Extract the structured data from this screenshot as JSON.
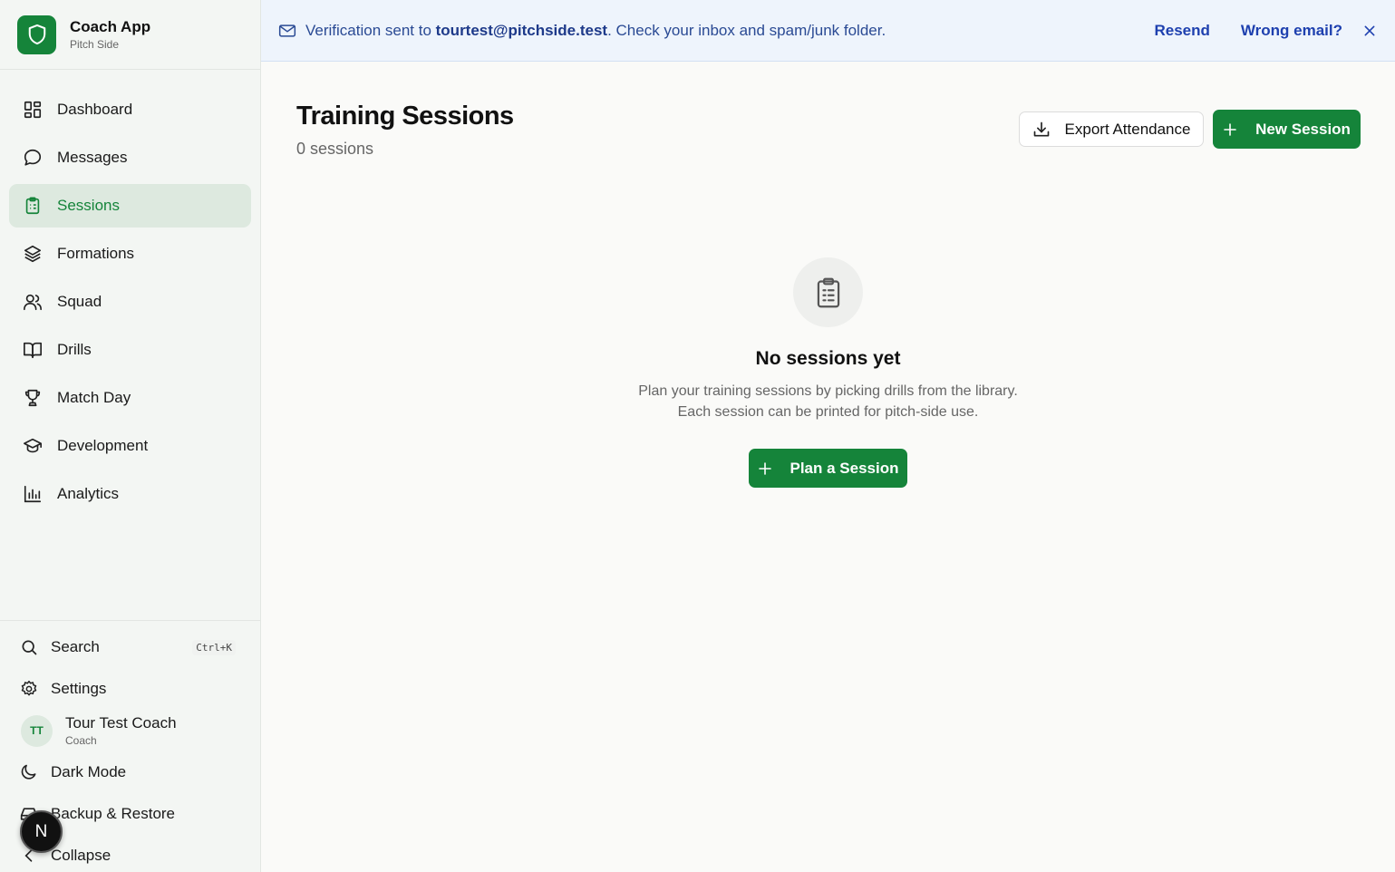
{
  "brand": {
    "title": "Coach App",
    "subtitle": "Pitch Side"
  },
  "nav": {
    "items": [
      {
        "label": "Dashboard",
        "icon": "dashboard-icon"
      },
      {
        "label": "Messages",
        "icon": "message-icon"
      },
      {
        "label": "Sessions",
        "icon": "clipboard-icon",
        "active": true
      },
      {
        "label": "Formations",
        "icon": "layers-icon"
      },
      {
        "label": "Squad",
        "icon": "users-icon"
      },
      {
        "label": "Drills",
        "icon": "book-icon"
      },
      {
        "label": "Match Day",
        "icon": "trophy-icon"
      },
      {
        "label": "Development",
        "icon": "graduation-cap-icon"
      },
      {
        "label": "Analytics",
        "icon": "bar-chart-icon"
      }
    ]
  },
  "bottom": {
    "search_label": "Search",
    "search_shortcut": "Ctrl+K",
    "settings_label": "Settings",
    "user_initials": "TT",
    "user_name": "Tour Test Coach",
    "user_role": "Coach",
    "dark_mode_label": "Dark Mode",
    "backup_label": "Backup & Restore",
    "collapse_label": "Collapse",
    "fab_label": "N"
  },
  "banner": {
    "prefix": "Verification sent to ",
    "email": "tourtest@pitchside.test",
    "suffix": ". Check your inbox and spam/junk folder.",
    "resend_label": "Resend",
    "wrong_email_label": "Wrong email?"
  },
  "header": {
    "title": "Training Sessions",
    "count_text": "0 sessions",
    "export_label": "Export Attendance",
    "new_label": "New Session"
  },
  "empty": {
    "title": "No sessions yet",
    "line1": "Plan your training sessions by picking drills from the library.",
    "line2": "Each session can be printed for pitch-side use.",
    "cta_label": "Plan a Session"
  },
  "colors": {
    "accent": "#15843a",
    "banner_bg": "#eef4fc",
    "banner_text": "#2a4a94",
    "sidebar_bg": "#f3f6f3"
  }
}
